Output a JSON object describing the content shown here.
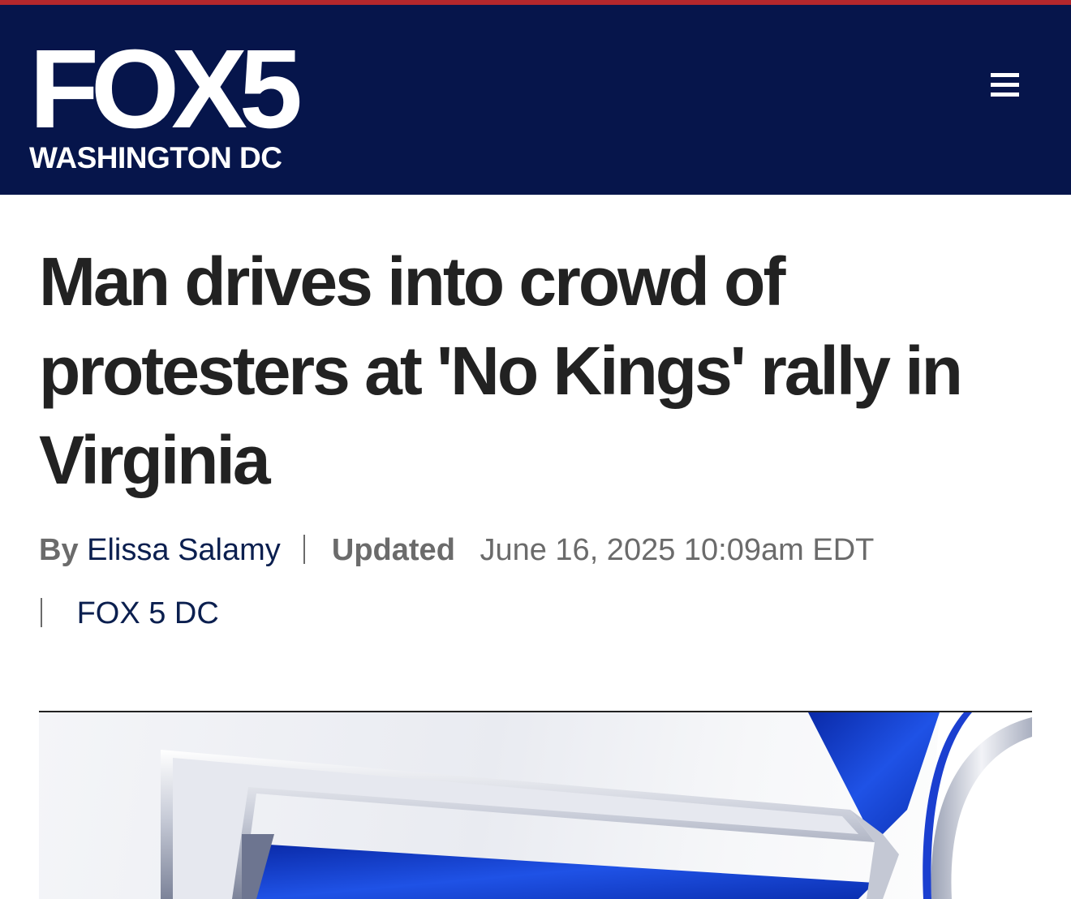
{
  "header": {
    "logo_main": "FOX5",
    "logo_sub": "WASHINGTON DC",
    "menu_icon": "hamburger-menu-icon"
  },
  "article": {
    "headline": "Man drives into crowd of protesters at 'No Kings' rally in Virginia",
    "byline_prefix": "By",
    "author": "Elissa Salamy",
    "updated_label": "Updated",
    "updated_date": "June 16, 2025 10:09am EDT",
    "source": "FOX 5 DC"
  },
  "colors": {
    "header_bg": "#06154b",
    "top_stripe": "#b3272c",
    "headline_text": "#222222",
    "link_text": "#0b1f4f"
  }
}
